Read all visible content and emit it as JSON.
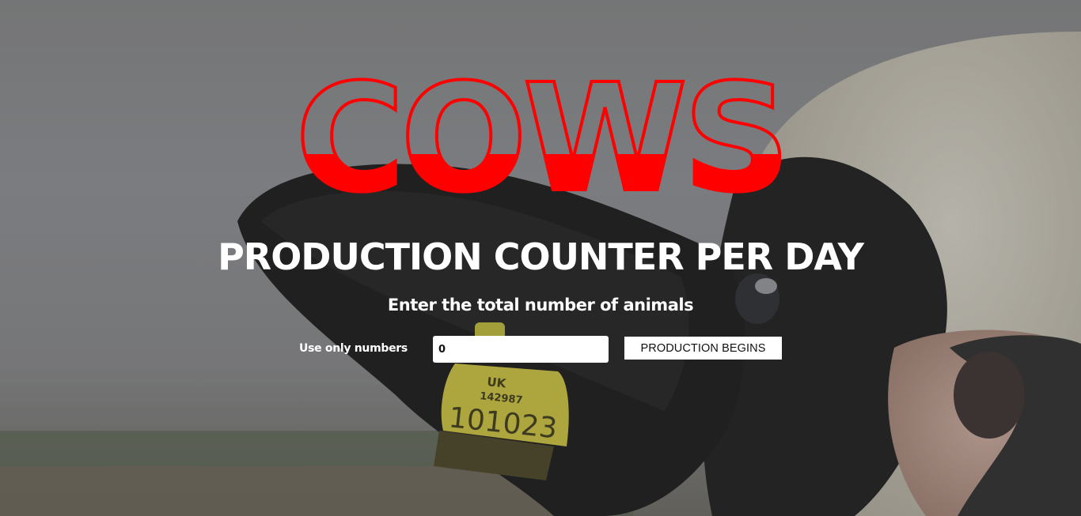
{
  "logo": {
    "text": "COWS",
    "color": "#ff0000"
  },
  "heading": "PRODUCTION COUNTER PER DAY",
  "subheading": "Enter the total number of animals",
  "form": {
    "hint": "Use only numbers",
    "animals_value": "0",
    "submit_label": "PRODUCTION BEGINS"
  },
  "background": {
    "ear_tag_line1": "UK",
    "ear_tag_line2": "142987",
    "ear_tag_number": "101023"
  }
}
